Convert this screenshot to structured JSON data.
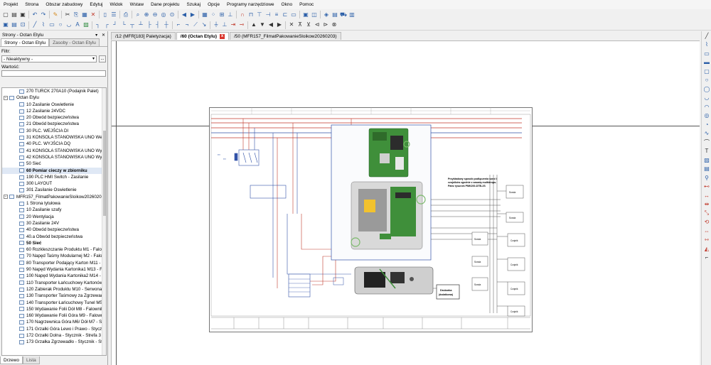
{
  "menu": [
    "Projekt",
    "Strona",
    "Obszar zabudowy",
    "Edytuj",
    "Widok",
    "Wstaw",
    "Dane projektu",
    "Szukaj",
    "Opcje",
    "Programy narzędziowe",
    "Okno",
    "Pomoc"
  ],
  "toolbar_icons_1": [
    {
      "name": "new-icon",
      "glyph": "▢",
      "tone": "blk"
    },
    {
      "name": "open-icon",
      "glyph": "▤",
      "tone": "blk"
    },
    {
      "name": "close-icon",
      "glyph": "▣",
      "tone": "blk"
    },
    {
      "name": "sep",
      "glyph": "",
      "tone": "sep"
    },
    {
      "name": "undo-icon",
      "glyph": "↶",
      "tone": "blu"
    },
    {
      "name": "redo-icon",
      "glyph": "↷",
      "tone": "blu"
    },
    {
      "name": "sep",
      "glyph": "",
      "tone": "sep"
    },
    {
      "name": "settings-icon",
      "glyph": "✎",
      "tone": "org"
    },
    {
      "name": "sep",
      "glyph": "",
      "tone": "sep"
    },
    {
      "name": "cut-icon",
      "glyph": "✂",
      "tone": "blk"
    },
    {
      "name": "copy-icon",
      "glyph": "⎘",
      "tone": "blu"
    },
    {
      "name": "paste-icon",
      "glyph": "▦",
      "tone": "blu"
    },
    {
      "name": "delete-icon",
      "glyph": "✕",
      "tone": "red"
    },
    {
      "name": "sep",
      "glyph": "",
      "tone": "sep"
    },
    {
      "name": "page-icon",
      "glyph": "▯",
      "tone": "blu"
    },
    {
      "name": "page-list-icon",
      "glyph": "☰",
      "tone": "blu"
    },
    {
      "name": "sep",
      "glyph": "",
      "tone": "sep"
    },
    {
      "name": "print-icon",
      "glyph": "⎙",
      "tone": "blu"
    },
    {
      "name": "sep",
      "glyph": "",
      "tone": "sep"
    },
    {
      "name": "zoom-window-icon",
      "glyph": "⌕",
      "tone": "blu"
    },
    {
      "name": "zoom-in-icon",
      "glyph": "⊕",
      "tone": "blu"
    },
    {
      "name": "zoom-out-icon",
      "glyph": "⊖",
      "tone": "blu"
    },
    {
      "name": "zoom-all-icon",
      "glyph": "◎",
      "tone": "blu"
    },
    {
      "name": "zoom-page-icon",
      "glyph": "⊙",
      "tone": "blu"
    },
    {
      "name": "sep",
      "glyph": "",
      "tone": "sep"
    },
    {
      "name": "back-icon",
      "glyph": "◀",
      "tone": "blu"
    },
    {
      "name": "forward-icon",
      "glyph": "▶",
      "tone": "blu"
    },
    {
      "name": "sep",
      "glyph": "",
      "tone": "sep"
    },
    {
      "name": "grid-icon",
      "glyph": "▦",
      "tone": "blu"
    },
    {
      "name": "grid-dots-icon",
      "glyph": "⁘",
      "tone": "blu"
    },
    {
      "name": "snap-icon",
      "glyph": "⊞",
      "tone": "blu"
    },
    {
      "name": "ortho-icon",
      "glyph": "⊥",
      "tone": "blu"
    },
    {
      "name": "sep",
      "glyph": "",
      "tone": "sep"
    },
    {
      "name": "connection-icon",
      "glyph": "∩",
      "tone": "red"
    },
    {
      "name": "bridge-icon",
      "glyph": "⊓",
      "tone": "blu"
    },
    {
      "name": "junction-icon",
      "glyph": "⊤",
      "tone": "blu"
    },
    {
      "name": "interrupt-icon",
      "glyph": "⊣",
      "tone": "blu"
    },
    {
      "name": "cable-icon",
      "glyph": "≡",
      "tone": "blu"
    },
    {
      "name": "shield-icon",
      "glyph": "⊏",
      "tone": "blu"
    },
    {
      "name": "potential-icon",
      "glyph": "▭",
      "tone": "blu"
    },
    {
      "name": "sep",
      "glyph": "",
      "tone": "sep"
    },
    {
      "name": "device-icon",
      "glyph": "▣",
      "tone": "blu"
    },
    {
      "name": "terminal-icon",
      "glyph": "◫",
      "tone": "blu"
    },
    {
      "name": "sep",
      "glyph": "",
      "tone": "sep"
    },
    {
      "name": "lock-icon",
      "glyph": "◈",
      "tone": "blu"
    },
    {
      "name": "table-icon",
      "glyph": "▤",
      "tone": "blu"
    },
    {
      "name": "cart-icon",
      "glyph": "⛟",
      "tone": "blu"
    },
    {
      "name": "parts-icon",
      "glyph": "▥",
      "tone": "blu"
    }
  ],
  "toolbar_icons_2": [
    {
      "name": "macro-icon",
      "glyph": "▣",
      "tone": "blu"
    },
    {
      "name": "layer-icon",
      "glyph": "▤",
      "tone": "blu"
    },
    {
      "name": "symbol-icon",
      "glyph": "⊡",
      "tone": "blu"
    },
    {
      "name": "sep",
      "glyph": "",
      "tone": "sep"
    },
    {
      "name": "line-icon",
      "glyph": "╱",
      "tone": "blu"
    },
    {
      "name": "polyline-icon",
      "glyph": "⌇",
      "tone": "blu"
    },
    {
      "name": "rect-icon",
      "glyph": "▭",
      "tone": "blu"
    },
    {
      "name": "circle-icon",
      "glyph": "○",
      "tone": "blu"
    },
    {
      "name": "arc-icon",
      "glyph": "◡",
      "tone": "blu"
    },
    {
      "name": "text-icon",
      "glyph": "A",
      "tone": "blu"
    },
    {
      "name": "image-icon",
      "glyph": "▨",
      "tone": "grn"
    },
    {
      "name": "sep",
      "glyph": "",
      "tone": "sep"
    },
    {
      "name": "corner-1-icon",
      "glyph": "┐",
      "tone": "blu"
    },
    {
      "name": "corner-2-icon",
      "glyph": "┌",
      "tone": "blu"
    },
    {
      "name": "corner-3-icon",
      "glyph": "┘",
      "tone": "blu"
    },
    {
      "name": "corner-4-icon",
      "glyph": "└",
      "tone": "blu"
    },
    {
      "name": "tee-1-icon",
      "glyph": "┬",
      "tone": "blu"
    },
    {
      "name": "tee-2-icon",
      "glyph": "┴",
      "tone": "blu"
    },
    {
      "name": "tee-3-icon",
      "glyph": "├",
      "tone": "blu"
    },
    {
      "name": "tee-4-icon",
      "glyph": "┤",
      "tone": "blu"
    },
    {
      "name": "cross-icon",
      "glyph": "┼",
      "tone": "blu"
    },
    {
      "name": "sep",
      "glyph": "",
      "tone": "sep"
    },
    {
      "name": "angle-1-icon",
      "glyph": "⌐",
      "tone": "blu"
    },
    {
      "name": "angle-2-icon",
      "glyph": "¬",
      "tone": "blu"
    },
    {
      "name": "diagonal-icon",
      "glyph": "⟋",
      "tone": "blu"
    },
    {
      "name": "arrow-icon",
      "glyph": "↘",
      "tone": "blu"
    },
    {
      "name": "sep",
      "glyph": "",
      "tone": "sep"
    },
    {
      "name": "ground-icon",
      "glyph": "⏚",
      "tone": "blu"
    },
    {
      "name": "pe-icon",
      "glyph": "⊥",
      "tone": "blu"
    },
    {
      "name": "signal-icon",
      "glyph": "⇥",
      "tone": "red"
    },
    {
      "name": "pin-icon",
      "glyph": "⊸",
      "tone": "red"
    },
    {
      "name": "sep",
      "glyph": "",
      "tone": "sep"
    },
    {
      "name": "triangle-1-icon",
      "glyph": "▲",
      "tone": "blk"
    },
    {
      "name": "triangle-2-icon",
      "glyph": "▼",
      "tone": "blk"
    },
    {
      "name": "triangle-3-icon",
      "glyph": "◀",
      "tone": "blk"
    },
    {
      "name": "triangle-4-icon",
      "glyph": "▶",
      "tone": "blk"
    },
    {
      "name": "sep",
      "glyph": "",
      "tone": "sep"
    },
    {
      "name": "wire-cross-icon",
      "glyph": "✕",
      "tone": "blk"
    },
    {
      "name": "wire-up-icon",
      "glyph": "⊼",
      "tone": "blk"
    },
    {
      "name": "wire-down-icon",
      "glyph": "⊻",
      "tone": "blk"
    },
    {
      "name": "wire-left-icon",
      "glyph": "⊲",
      "tone": "blk"
    },
    {
      "name": "wire-right-icon",
      "glyph": "⊳",
      "tone": "blk"
    },
    {
      "name": "wire-join-icon",
      "glyph": "⊗",
      "tone": "blk"
    }
  ],
  "right_toolbar_icons": [
    {
      "name": "line-tool-icon",
      "glyph": "╱",
      "tone": "blk"
    },
    {
      "name": "polyline-tool-icon",
      "glyph": "⌇",
      "tone": "blu"
    },
    {
      "name": "rect-tool-icon",
      "glyph": "▭",
      "tone": "blu"
    },
    {
      "name": "rect-fill-tool-icon",
      "glyph": "▬",
      "tone": "blu"
    },
    {
      "name": "rect-round-tool-icon",
      "glyph": "▢",
      "tone": "blu"
    },
    {
      "name": "circle-tool-icon",
      "glyph": "○",
      "tone": "blu"
    },
    {
      "name": "circle-2-tool-icon",
      "glyph": "◯",
      "tone": "blu"
    },
    {
      "name": "arc-tool-icon",
      "glyph": "◡",
      "tone": "blu"
    },
    {
      "name": "arc-2-tool-icon",
      "glyph": "◠",
      "tone": "blu"
    },
    {
      "name": "ellipse-tool-icon",
      "glyph": "◎",
      "tone": "blu"
    },
    {
      "name": "sector-tool-icon",
      "glyph": "◔",
      "tone": "blu"
    },
    {
      "name": "curve-tool-icon",
      "glyph": "∿",
      "tone": "blu"
    },
    {
      "name": "spline-tool-icon",
      "glyph": "⌒",
      "tone": "blk"
    },
    {
      "name": "text-tool-icon",
      "glyph": "T",
      "tone": "blk"
    },
    {
      "name": "image-tool-icon",
      "glyph": "▨",
      "tone": "blu"
    },
    {
      "name": "dimension-tool-icon",
      "glyph": "▤",
      "tone": "blu"
    },
    {
      "name": "hyperlink-tool-icon",
      "glyph": "⚲",
      "tone": "blu"
    },
    {
      "name": "measure-tool-icon",
      "glyph": "⊷",
      "tone": "red"
    },
    {
      "name": "dim-h-tool-icon",
      "glyph": "↔",
      "tone": "red"
    },
    {
      "name": "dim-v-tool-icon",
      "glyph": "⇹",
      "tone": "red"
    },
    {
      "name": "dim-a-tool-icon",
      "glyph": "⤡",
      "tone": "red"
    },
    {
      "name": "dim-r-tool-icon",
      "glyph": "⟲",
      "tone": "red"
    },
    {
      "name": "dim-d-tool-icon",
      "glyph": "⇔",
      "tone": "red"
    },
    {
      "name": "dim-chain-tool-icon",
      "glyph": "⇿",
      "tone": "red"
    },
    {
      "name": "shape-tool-icon",
      "glyph": "◭",
      "tone": "red"
    },
    {
      "name": "leader-tool-icon",
      "glyph": "⌐",
      "tone": "blk"
    }
  ],
  "panel": {
    "title": "Strony - Octan Etylu",
    "controls": [
      "▾",
      "✕"
    ],
    "tabs": [
      "Strony - Octan Etylu",
      "Zasoby - Octan Etylu"
    ],
    "filter_label": "Filtr:",
    "filter_value": "- Nieaktywny -",
    "filter_more": "...",
    "value_label": "Wartość:"
  },
  "tree": [
    {
      "text": "270 TURCK 270A10 (Podajnik Palet)",
      "level": 2
    },
    {
      "text": "Octan Etylu",
      "level": 1,
      "expanded": true
    },
    {
      "text": "10 Zasilanie Oswietlenie",
      "level": 2
    },
    {
      "text": "12 Zasilanie 24VDC",
      "level": 2
    },
    {
      "text": "20 Obwód bezpieczeństwa",
      "level": 2
    },
    {
      "text": "21 Obwód bezpieczeństwa",
      "level": 2
    },
    {
      "text": "30 PLC. WEJŚCIA DI",
      "level": 2
    },
    {
      "text": "31 KONSOLA STANOWISKA UNO Wejśc",
      "level": 2
    },
    {
      "text": "40 PLC. WYJŚCIA DQ",
      "level": 2
    },
    {
      "text": "41 KONSOLA STANOWISKA UNO Wyjśc",
      "level": 2
    },
    {
      "text": "42 KONSOLA STANOWISKA UNO Wyjśc",
      "level": 2
    },
    {
      "text": "50 Sieć",
      "level": 2
    },
    {
      "text": "60 Pomiar cieczy w zbiorniku",
      "level": 2,
      "bold": true,
      "selected": true
    },
    {
      "text": "190 PLC HMI Switch - Zasilanie",
      "level": 2
    },
    {
      "text": "300 LAYOUT",
      "level": 2
    },
    {
      "text": "301 Zasilanie Oswietlenie",
      "level": 2
    },
    {
      "text": "MFR157_FilmatPakowanieSloikow20260203",
      "level": 1,
      "expanded": true
    },
    {
      "text": "1 Strona tytułowa",
      "level": 2
    },
    {
      "text": "10 Zasilanie szafy",
      "level": 2
    },
    {
      "text": "20 Wentylacja",
      "level": 2
    },
    {
      "text": "30 Zasilanie 24V",
      "level": 2
    },
    {
      "text": "40 Obwód bezpieczeństwa",
      "level": 2
    },
    {
      "text": "40.a Obwód bezpieczeństwa",
      "level": 2
    },
    {
      "text": "50 Sieć",
      "level": 2,
      "bold": true
    },
    {
      "text": "60 Rozkleszczanie Produktu M1 - Falow",
      "level": 2
    },
    {
      "text": "70 Napęd Taśmy Modularnej M2 - Falo",
      "level": 2
    },
    {
      "text": "80 Transporter Podający Karton M11 - S",
      "level": 2
    },
    {
      "text": "90 Napęd Wydania Kartonika1 M13 - F",
      "level": 2
    },
    {
      "text": "100 Napęd Wydania Kartonika2 M14 - F",
      "level": 2
    },
    {
      "text": "110 Transporter Łańcuchowy Kartonów",
      "level": 2
    },
    {
      "text": "120 Zabierak Produktu M10 - Serwonap",
      "level": 2
    },
    {
      "text": "130 Transporter Taśmowy za Zgrzewadł",
      "level": 2
    },
    {
      "text": "140 Transporter Łańcuchowy Tunel M5",
      "level": 2
    },
    {
      "text": "150 Wydawanie Folii Dół M8 - Falownik",
      "level": 2
    },
    {
      "text": "160 Wydawanie Folii Góra M9 - Falown",
      "level": 2
    },
    {
      "text": "170 Nagrzewnica Góra M6/ Dół M7 - St",
      "level": 2
    },
    {
      "text": "171 Grzałki Góra Lewo i Prawo - Stycznik",
      "level": 2
    },
    {
      "text": "172 Grzałki Dolna - Stycznik - Strefa 3",
      "level": 2
    },
    {
      "text": "173 Grzałka Zgrzewadło - Stycznik - Str",
      "level": 2
    }
  ],
  "bottom_tabs": [
    "Drzewo",
    "Lista"
  ],
  "doc_tabs": [
    {
      "label": "/12 (MFR[183] Paletyzacja)",
      "active": false
    },
    {
      "label": "/60 (Octan Etylu)",
      "active": true,
      "close": "x"
    },
    {
      "label": "/50 (MFR157_FilmatPakowanieSloikow20260203)",
      "active": false
    }
  ],
  "drawing": {
    "note_lines": [
      "Przykładowy sposób podłączenia sond i",
      "czujników zgodnie z zasadą multidropu.",
      "Patrz rysunek PMK200-DTB-2S"
    ],
    "sonda_labels": [
      "Sonda",
      "Sonda",
      "Sonda",
      "Sonda",
      "Sonda"
    ],
    "czujnik_labels": [
      "Czujnik",
      "Czujnik",
      "Czujnik",
      "Czujnik"
    ],
    "printer_label": [
      "Drukarka",
      "(dodatkowa)"
    ]
  },
  "colors": {
    "accent": "#2b5fa8",
    "wire_red": "#c0392b",
    "wire_blue": "#3253a8",
    "pcb_green": "#3f8f3a",
    "selection": "#dfe8f5"
  }
}
